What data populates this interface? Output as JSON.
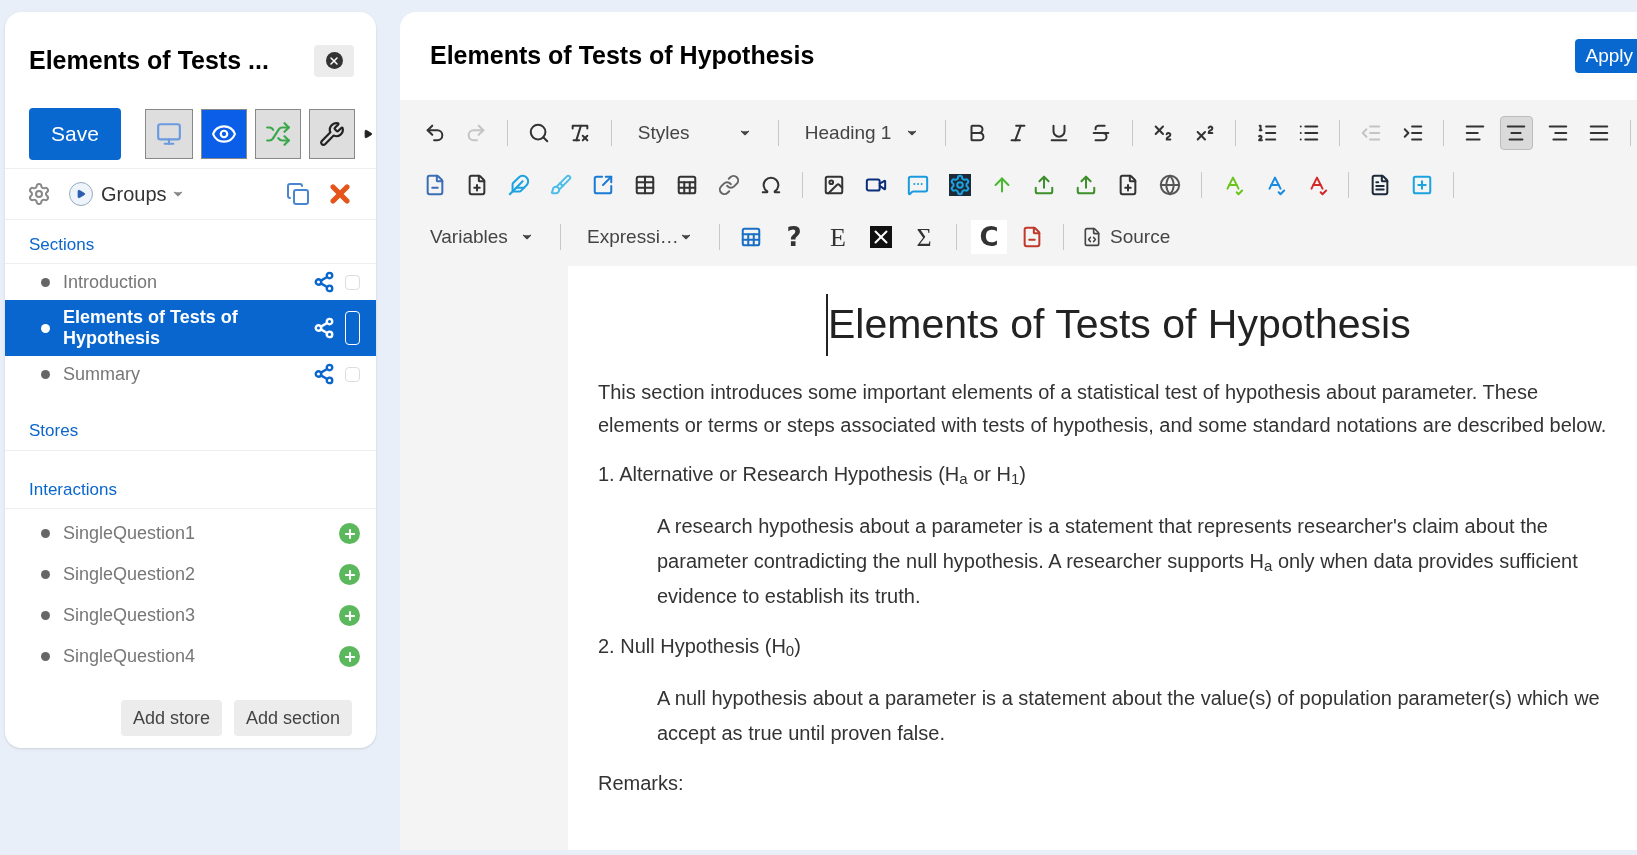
{
  "side_panel": {
    "title": "Elements of Tests ...",
    "save_button": "Save",
    "mode_buttons": [
      {
        "selected": false
      },
      {
        "selected": true
      },
      {
        "selected": false
      },
      {
        "selected": false
      }
    ],
    "groups_label": "Groups",
    "sections": {
      "heading": "Sections",
      "items": [
        {
          "label": "Introduction",
          "selected": false,
          "checked": false
        },
        {
          "label": "Elements of Tests of Hypothesis",
          "selected": true,
          "checked": false
        },
        {
          "label": "Summary",
          "selected": false,
          "checked": false
        }
      ]
    },
    "stores": {
      "heading": "Stores"
    },
    "interactions": {
      "heading": "Interactions",
      "items": [
        {
          "label": "SingleQuestion1"
        },
        {
          "label": "SingleQuestion2"
        },
        {
          "label": "SingleQuestion3"
        },
        {
          "label": "SingleQuestion4"
        }
      ]
    },
    "buttons": [
      "Add store",
      "Add section"
    ]
  },
  "editor": {
    "title": "Elements of Tests of Hypothesis",
    "apply_button": "Apply",
    "toolbar": {
      "history": [
        {
          "disabled": false
        },
        {
          "disabled": true
        }
      ],
      "indent": [
        {
          "disabled": true
        },
        {
          "disabled": false
        }
      ],
      "alignment": [
        {
          "selected": false
        },
        {
          "selected": true
        },
        {
          "selected": false
        },
        {
          "selected": false
        }
      ],
      "dropdowns": [
        "Styles",
        "Heading 1",
        "Variables",
        "Expressi…"
      ],
      "symbols": [
        "?",
        "E",
        "Σ",
        "C"
      ],
      "source_button": "Source"
    },
    "document": {
      "heading": "Elements of Tests of Hypothesis",
      "blocks": [
        {
          "kind": "para",
          "text": "This section introduces some important elements of a statistical test of hypothesis about parameter. These elements  or terms or steps  associated with tests of hypothesis, and some standard notations are described below."
        },
        {
          "kind": "item",
          "text": "1. Alternative or Research Hypothesis (H$_{a}$   or H$_{1}$)"
        },
        {
          "kind": "indented",
          "text": "A research hypothesis about a parameter  is a statement that represents researcher's claim about the parameter contradicting the null hypothesis. A researcher supports H$_{a}$ only when data provides sufficient evidence to establish its truth."
        },
        {
          "kind": "item",
          "text": "2. Null Hypothesis (H$_{0}$)"
        },
        {
          "kind": "indented",
          "text": "A null hypothesis  about a parameter is a statement  about the value(s) of population parameter(s) which  we accept as true until proven false."
        },
        {
          "kind": "para",
          "text": "Remarks:"
        }
      ]
    }
  }
}
